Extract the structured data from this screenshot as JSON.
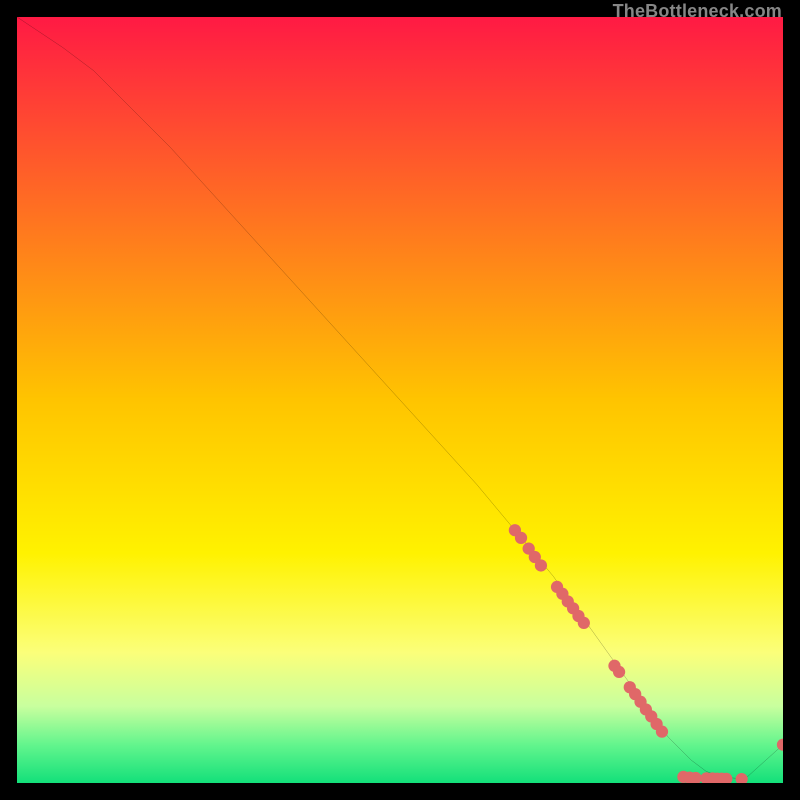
{
  "watermark": "TheBottleneck.com",
  "chart_data": {
    "type": "line",
    "title": "",
    "xlabel": "",
    "ylabel": "",
    "xlim": [
      0,
      100
    ],
    "ylim": [
      0,
      100
    ],
    "grid": false,
    "legend": false,
    "background_gradient": {
      "stops": [
        {
          "pos": 0.0,
          "color": "#ff1a44"
        },
        {
          "pos": 0.5,
          "color": "#ffc400"
        },
        {
          "pos": 0.7,
          "color": "#fff200"
        },
        {
          "pos": 0.83,
          "color": "#fbff7a"
        },
        {
          "pos": 0.9,
          "color": "#c8ff9e"
        },
        {
          "pos": 0.95,
          "color": "#63f58d"
        },
        {
          "pos": 1.0,
          "color": "#13e07a"
        }
      ]
    },
    "series": [
      {
        "name": "bottleneck-curve",
        "color": "#000000",
        "x": [
          0,
          3,
          6,
          10,
          15,
          20,
          30,
          40,
          50,
          60,
          65,
          70,
          75,
          80,
          85,
          88,
          90,
          92,
          95,
          100
        ],
        "y": [
          100,
          98,
          96,
          93,
          88,
          83,
          72,
          61,
          50,
          39,
          33,
          27,
          20,
          13,
          6,
          3,
          1.5,
          0.8,
          0.5,
          5
        ]
      }
    ],
    "points": {
      "name": "sample-points",
      "color": "#e06868",
      "radius_frac": 0.008,
      "data": [
        {
          "x": 65.0,
          "y": 33.0
        },
        {
          "x": 65.8,
          "y": 32.0
        },
        {
          "x": 66.8,
          "y": 30.6
        },
        {
          "x": 67.6,
          "y": 29.5
        },
        {
          "x": 68.4,
          "y": 28.4
        },
        {
          "x": 70.5,
          "y": 25.6
        },
        {
          "x": 71.2,
          "y": 24.7
        },
        {
          "x": 71.9,
          "y": 23.7
        },
        {
          "x": 72.6,
          "y": 22.8
        },
        {
          "x": 73.3,
          "y": 21.8
        },
        {
          "x": 74.0,
          "y": 20.9
        },
        {
          "x": 78.0,
          "y": 15.3
        },
        {
          "x": 78.6,
          "y": 14.5
        },
        {
          "x": 80.0,
          "y": 12.5
        },
        {
          "x": 80.7,
          "y": 11.6
        },
        {
          "x": 81.4,
          "y": 10.6
        },
        {
          "x": 82.1,
          "y": 9.6
        },
        {
          "x": 82.8,
          "y": 8.7
        },
        {
          "x": 83.5,
          "y": 7.7
        },
        {
          "x": 84.2,
          "y": 6.7
        },
        {
          "x": 87.0,
          "y": 0.8
        },
        {
          "x": 87.8,
          "y": 0.7
        },
        {
          "x": 88.6,
          "y": 0.65
        },
        {
          "x": 90.0,
          "y": 0.6
        },
        {
          "x": 90.8,
          "y": 0.58
        },
        {
          "x": 91.4,
          "y": 0.56
        },
        {
          "x": 92.0,
          "y": 0.55
        },
        {
          "x": 92.6,
          "y": 0.53
        },
        {
          "x": 94.6,
          "y": 0.5
        },
        {
          "x": 100.0,
          "y": 5.0
        }
      ]
    }
  }
}
